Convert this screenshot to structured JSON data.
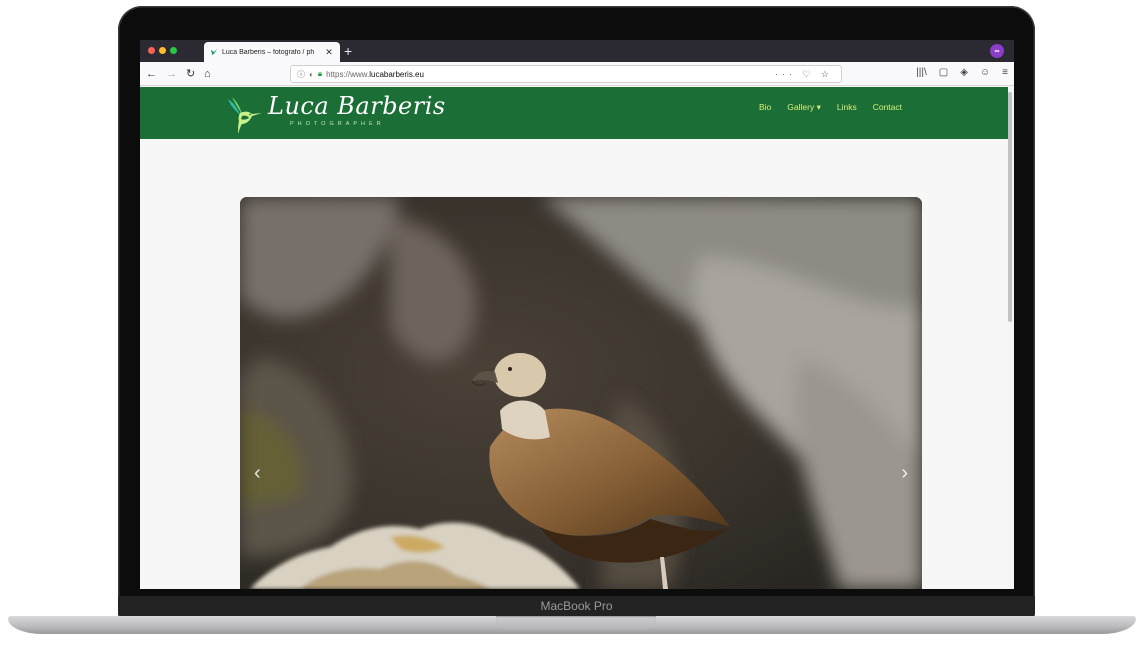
{
  "device": {
    "model_label": "MacBook Pro"
  },
  "browser": {
    "tab": {
      "title": "Luca Barberis – fotografo / ph",
      "close_glyph": "✕"
    },
    "new_tab_glyph": "+",
    "profile_initials": "∞",
    "nav": {
      "back": "←",
      "forward": "→",
      "reload": "↻",
      "home": "⌂"
    },
    "url": {
      "scheme": "https://www.",
      "domain": "lucabarberis.eu"
    },
    "url_actions": "··· ♡ ☆",
    "toolbar_icons": [
      "|||\\",
      "▢",
      "◈",
      "☺",
      "≡"
    ]
  },
  "site": {
    "brand_name": "Luca Barberis",
    "brand_tagline": "PHOTOGRAPHER",
    "nav": [
      {
        "label": "Bio"
      },
      {
        "label": "Gallery ▾"
      },
      {
        "label": "Links"
      },
      {
        "label": "Contact"
      }
    ],
    "carousel": {
      "prev_glyph": "‹",
      "next_glyph": "›"
    }
  },
  "colors": {
    "header_green": "#1a6e36",
    "nav_link": "#d8f07a",
    "browser_dark": "#2b2a33"
  }
}
